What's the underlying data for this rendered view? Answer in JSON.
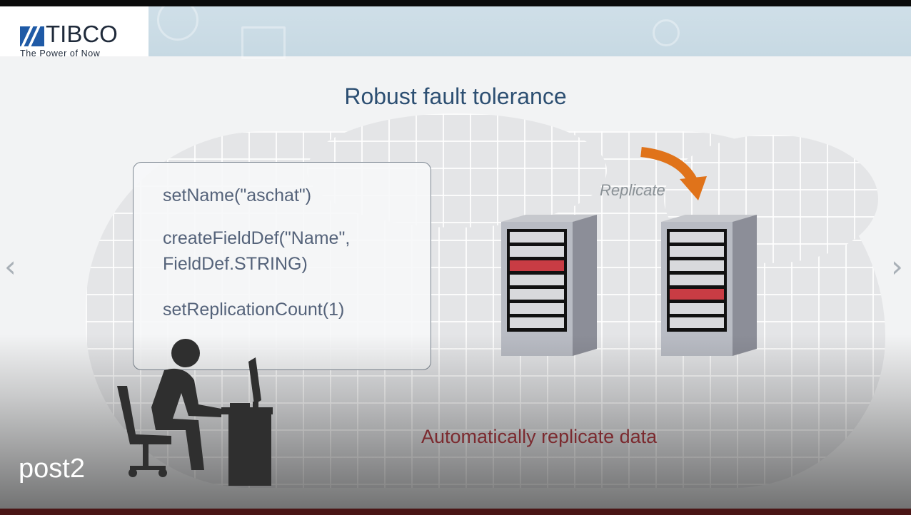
{
  "logo": {
    "wordmark": "TIBCO",
    "tagline": "The Power of Now"
  },
  "slide": {
    "title": "Robust fault tolerance",
    "code_lines": [
      "setName(\"aschat\")",
      "createFieldDef(\"Name\",",
      "FieldDef.STRING)",
      "setReplicationCount(1)"
    ],
    "replicate_label": "Replicate",
    "caption": "Automatically replicate data"
  },
  "overlay_label": "post2",
  "colors": {
    "title": "#2d4f72",
    "code": "#55637a",
    "caption": "#7b2a2f",
    "arrow": "#e0731a",
    "highlight": "#c83c44",
    "logo_blue": "#1f5aa6"
  },
  "icons": {
    "prev": "chevron-left-icon",
    "next": "chevron-right-icon",
    "arrow": "curved-arrow-icon",
    "user": "person-at-computer-icon",
    "server": "server-rack-icon"
  }
}
